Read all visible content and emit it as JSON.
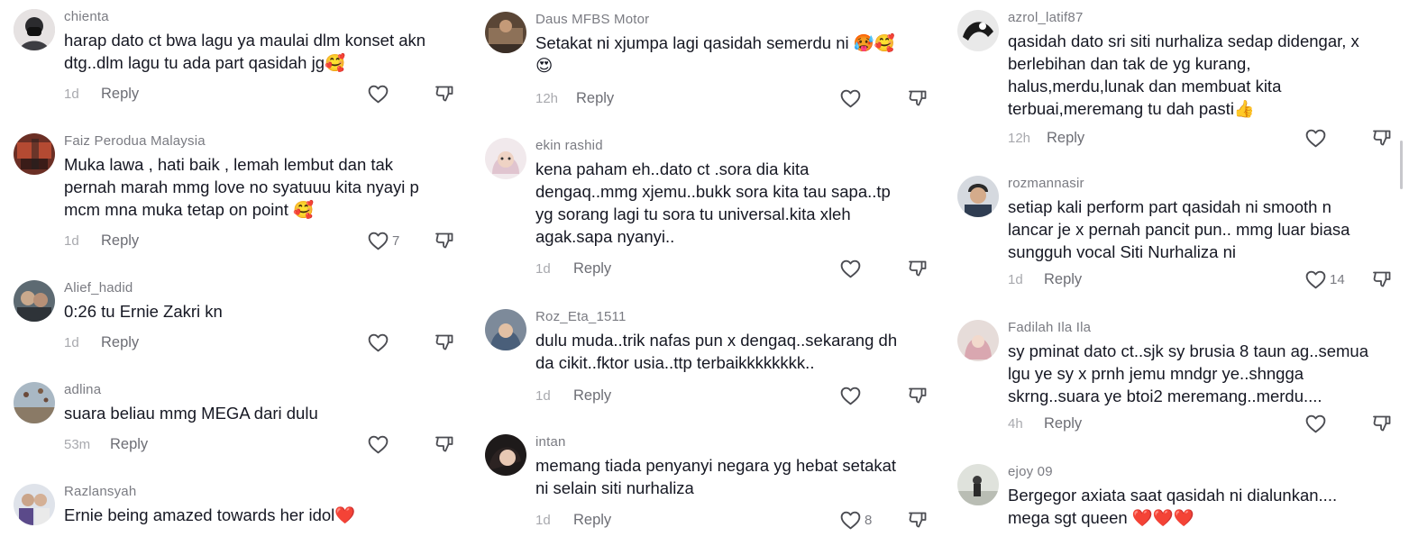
{
  "columns": [
    {
      "comments": [
        {
          "username": "chienta",
          "text": "harap dato ct bwa lagu ya maulai dlm konset akn\ndtg..dlm lagu tu ada part qasidah jg🥰",
          "time": "1d",
          "reply": "Reply",
          "likes": ""
        },
        {
          "username": "Faiz Perodua Malaysia",
          "text": "Muka lawa , hati baik , lemah lembut dan tak\npernah marah mmg love no syatuuu kita nyayi p\nmcm mna muka tetap on point 🥰",
          "time": "1d",
          "reply": "Reply",
          "likes": "7"
        },
        {
          "username": "Alief_hadid",
          "text": "0:26 tu Ernie Zakri kn",
          "time": "1d",
          "reply": "Reply",
          "likes": ""
        },
        {
          "username": "adlina",
          "text": "suara beliau mmg MEGA dari dulu",
          "time": "53m",
          "reply": "Reply",
          "likes": ""
        },
        {
          "username": "Razlansyah",
          "text": "Ernie being amazed towards her idol❤️",
          "time": "",
          "reply": "",
          "likes": ""
        }
      ]
    },
    {
      "comments": [
        {
          "username": "Daus MFBS Motor",
          "text": "Setakat ni xjumpa lagi qasidah semerdu ni 🥵🥰\n😍",
          "time": "12h",
          "reply": "Reply",
          "likes": ""
        },
        {
          "username": "ekin rashid",
          "text": "kena paham eh..dato ct .sora dia kita\ndengaq..mmg xjemu..bukk sora kita tau sapa..tp\nyg sorang lagi tu sora tu universal.kita xleh\nagak.sapa nyanyi..",
          "time": "1d",
          "reply": "Reply",
          "likes": ""
        },
        {
          "username": "Roz_Eta_1511",
          "text": "dulu muda..trik nafas pun x dengaq..sekarang dh\nda cikit..fktor usia..ttp terbaikkkkkkkk..",
          "time": "1d",
          "reply": "Reply",
          "likes": ""
        },
        {
          "username": "intan",
          "text": "memang tiada penyanyi negara yg hebat setakat\nni selain siti nurhaliza",
          "time": "1d",
          "reply": "Reply",
          "likes": "8"
        }
      ]
    },
    {
      "comments": [
        {
          "username": "azrol_latif87",
          "text": "qasidah dato sri siti nurhaliza sedap didengar, x\nberlebihan dan tak de yg kurang,\nhalus,merdu,lunak dan membuat kita\nterbuai,meremang tu dah pasti👍",
          "time": "12h",
          "reply": "Reply",
          "likes": ""
        },
        {
          "username": "rozmannasir",
          "text": "setiap kali perform part qasidah ni smooth n\nlancar je x pernah pancit pun.. mmg luar biasa\nsungguh vocal Siti Nurhaliza ni",
          "time": "1d",
          "reply": "Reply",
          "likes": "14"
        },
        {
          "username": "Fadilah Ila Ila",
          "text": "sy pminat dato ct..sjk sy brusia 8 taun ag..semua\nlgu ye sy x prnh jemu mndgr ye..shngga\nskrng..suara ye btoi2 meremang..merdu....",
          "time": "4h",
          "reply": "Reply",
          "likes": ""
        },
        {
          "username": "ejoy 09",
          "text": "Bergegor axiata saat qasidah ni dialunkan....\nmega sgt queen ❤️❤️❤️",
          "time": "",
          "reply": "",
          "likes": ""
        }
      ]
    }
  ]
}
